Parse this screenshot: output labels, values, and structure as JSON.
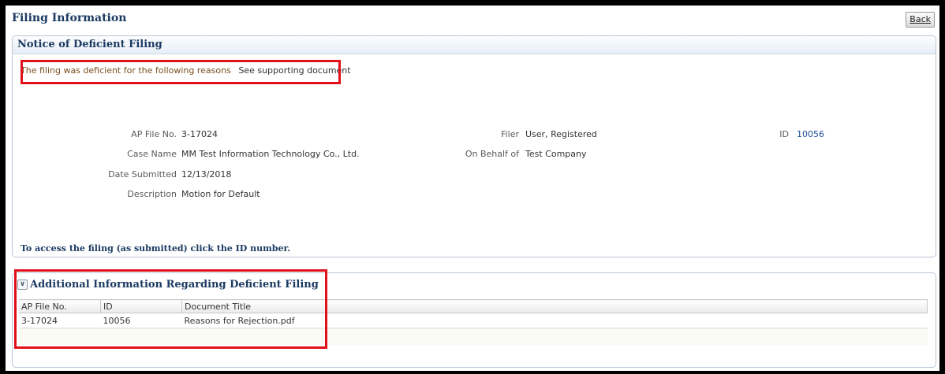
{
  "header": {
    "title": "Filing Information",
    "back_label": "Back"
  },
  "notice": {
    "title": "Notice of Deficient Filing",
    "reason_label": "The filing was deficient for the following reasons",
    "reason_value": "See supporting document",
    "fields": {
      "ap_file_no_label": "AP File No.",
      "ap_file_no": "3-17024",
      "case_name_label": "Case Name",
      "case_name": "MM Test Information Technology Co., Ltd.",
      "date_submitted_label": "Date Submitted",
      "date_submitted": "12/13/2018",
      "description_label": "Description",
      "description": "Motion for Default",
      "filer_label": "Filer",
      "filer": "User, Registered",
      "on_behalf_label": "On Behalf of",
      "on_behalf": "Test Company",
      "id_label": "ID",
      "id": "10056"
    },
    "access_note": "To access the filing (as submitted) click the ID number."
  },
  "additional": {
    "title": "Additional Information Regarding Deficient Filing",
    "toggle_icon": "collapse-chevron-icon",
    "columns": [
      "AP File No.",
      "ID",
      "Document Title"
    ],
    "rows": [
      {
        "ap_file_no": "3-17024",
        "id": "10056",
        "document_title": "Reasons for Rejection.pdf"
      }
    ]
  },
  "colors": {
    "heading": "#1b3a62",
    "link": "#1f4f9a",
    "highlight": "#e0101a"
  }
}
